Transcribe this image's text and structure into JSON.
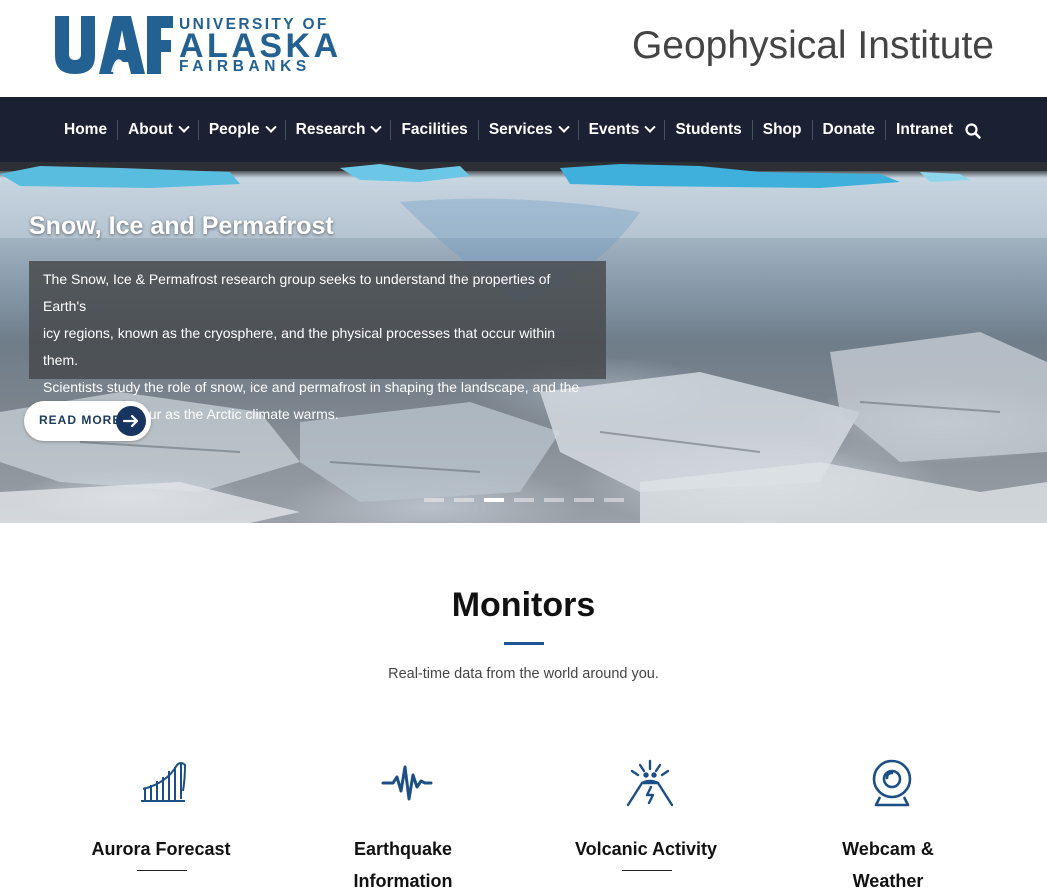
{
  "header": {
    "logo": {
      "mark": "UAF",
      "line1": "UNIVERSITY OF",
      "line2": "ALASKA",
      "line3": "FAIRBANKS"
    },
    "site_title": "Geophysical Institute"
  },
  "nav": {
    "items": [
      {
        "label": "Home",
        "dropdown": false
      },
      {
        "label": "About",
        "dropdown": true
      },
      {
        "label": "People",
        "dropdown": true
      },
      {
        "label": "Research",
        "dropdown": true
      },
      {
        "label": "Facilities",
        "dropdown": false
      },
      {
        "label": "Services",
        "dropdown": true
      },
      {
        "label": "Events",
        "dropdown": true
      },
      {
        "label": "Students",
        "dropdown": false
      },
      {
        "label": "Shop",
        "dropdown": false
      },
      {
        "label": "Donate",
        "dropdown": false
      },
      {
        "label": "Intranet",
        "dropdown": false
      }
    ],
    "search_icon": "search-icon"
  },
  "hero": {
    "title": "Snow, Ice and Permafrost",
    "description_lines": [
      "The Snow, Ice & Permafrost research group seeks to understand the properties of Earth's",
      "icy regions, known as the cryosphere, and the physical processes that occur within them.",
      "Scientists study the role of snow, ice and permafrost in shaping the landscape, and the",
      "changes that occur as the Arctic climate warms."
    ],
    "read_more_label": "READ MORE",
    "slides_count": 7,
    "active_slide": 3
  },
  "monitors": {
    "title": "Monitors",
    "subtitle": "Real-time data from the world around you.",
    "cards": [
      {
        "title_lines": [
          "Aurora Forecast"
        ],
        "icon": "aurora-icon"
      },
      {
        "title_lines": [
          "Earthquake",
          "Information"
        ],
        "icon": "seismograph-icon"
      },
      {
        "title_lines": [
          "Volcanic Activity"
        ],
        "icon": "volcano-icon"
      },
      {
        "title_lines": [
          "Webcam &",
          "Weather"
        ],
        "icon": "webcam-icon"
      }
    ]
  },
  "colors": {
    "brand_blue": "#236192",
    "nav_bg": "#1b2033",
    "accent_blue": "#1f5596",
    "icon_blue": "#1b4f86"
  }
}
